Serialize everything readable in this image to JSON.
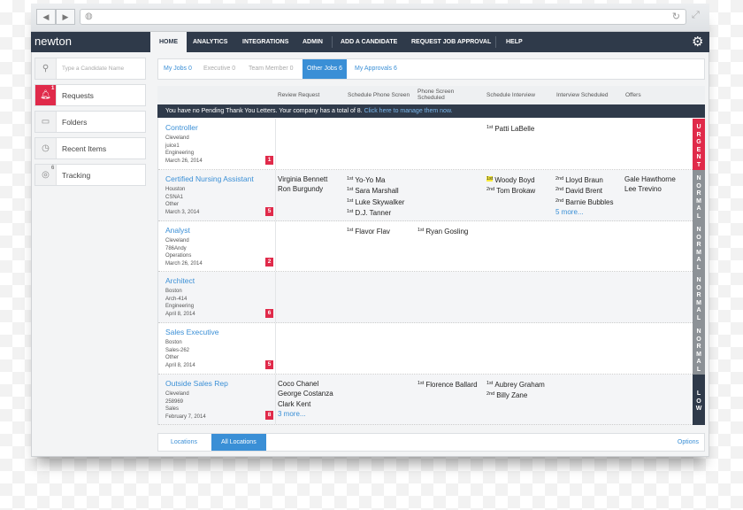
{
  "brand": "newton",
  "colors": {
    "accent": "#3a8fd6",
    "nav": "#2f3a4a",
    "urgent": "#e02a4a",
    "normal": "#8c9196",
    "low": "#2f3a4a"
  },
  "nav": {
    "items": [
      "HOME",
      "ANALYTICS",
      "INTEGRATIONS",
      "ADMIN",
      "ADD A CANDIDATE",
      "REQUEST JOB APPROVAL",
      "HELP"
    ],
    "settings_icon": "gear-icon"
  },
  "sidebar": {
    "search_placeholder": "Type a Candidate Name",
    "items": [
      {
        "label": "Requests",
        "badge": "1",
        "icon": "bell-icon"
      },
      {
        "label": "Folders",
        "icon": "folder-icon"
      },
      {
        "label": "Recent Items",
        "icon": "clock-icon"
      },
      {
        "label": "Tracking",
        "badge": "6",
        "icon": "target-icon"
      }
    ]
  },
  "tabs": [
    "My Jobs 0",
    "Executive 0",
    "Team Member 0",
    "Other Jobs 6",
    "My Approvals 6"
  ],
  "columns": [
    "Review Request",
    "Schedule Phone Screen",
    "Phone Screen Scheduled",
    "Schedule Interview",
    "Interview Scheduled",
    "Offers"
  ],
  "banner": {
    "text": "You have no Pending Thank You Letters. Your company has a total of 8. ",
    "link": "Click here to manage them now."
  },
  "jobs": [
    {
      "title": "Controller",
      "meta": [
        "Cleveland",
        "juice1",
        "Engineering",
        "March 26, 2014"
      ],
      "count": "1",
      "priority": "URGENT",
      "cells": [
        [],
        [],
        [],
        [
          {
            "rank": "1st",
            "name": "Patti LaBelle"
          }
        ],
        [],
        []
      ]
    },
    {
      "title": "Certified Nursing Assistant",
      "meta": [
        "Houston",
        "CSNA1",
        "Other",
        "March 3, 2014"
      ],
      "count": "5",
      "priority": "NORMAL",
      "cells": [
        [
          {
            "name": "Virginia Bennett"
          },
          {
            "name": "Ron Burgundy"
          }
        ],
        [
          {
            "rank": "1st",
            "name": "Yo-Yo Ma"
          },
          {
            "rank": "1st",
            "name": "Sara Marshall"
          },
          {
            "rank": "1st",
            "name": "Luke Skywalker"
          },
          {
            "rank": "1st",
            "name": "D.J. Tanner"
          }
        ],
        [],
        [
          {
            "rank": "1st",
            "name": "Woody Boyd",
            "highlight": true
          },
          {
            "rank": "2nd",
            "name": "Tom Brokaw"
          }
        ],
        [
          {
            "rank": "2nd",
            "name": "Lloyd Braun"
          },
          {
            "rank": "2nd",
            "name": "David Brent"
          },
          {
            "rank": "2nd",
            "name": "Barnie Bubbles"
          },
          {
            "more": "5 more..."
          }
        ],
        [
          {
            "name": "Gale Hawthorne"
          },
          {
            "name": "Lee Trevino"
          }
        ]
      ]
    },
    {
      "title": "Analyst",
      "meta": [
        "Cleveland",
        "786Andy",
        "Operations",
        "March 26, 2014"
      ],
      "count": "2",
      "priority": "NORMAL",
      "cells": [
        [],
        [
          {
            "rank": "1st",
            "name": "Flavor Flav"
          }
        ],
        [
          {
            "rank": "1st",
            "name": "Ryan Gosling"
          }
        ],
        [],
        [],
        []
      ]
    },
    {
      "title": "Architect",
      "meta": [
        "Boston",
        "Arch-414",
        "Engineering",
        "April 8, 2014"
      ],
      "count": "6",
      "priority": "NORMAL",
      "cells": [
        [],
        [],
        [],
        [],
        [],
        []
      ]
    },
    {
      "title": "Sales Executive",
      "meta": [
        "Boston",
        "Sales-262",
        "Other",
        "April 8, 2014"
      ],
      "count": "5",
      "priority": "NORMAL",
      "cells": [
        [],
        [],
        [],
        [],
        [],
        []
      ]
    },
    {
      "title": "Outside Sales Rep",
      "meta": [
        "Cleveland",
        "258969",
        "Sales",
        "February 7, 2014"
      ],
      "count": "8",
      "priority": "LOW",
      "cells": [
        [
          {
            "name": "Coco Chanel"
          },
          {
            "name": "George Costanza"
          },
          {
            "name": "Clark Kent"
          },
          {
            "more": "3 more..."
          }
        ],
        [],
        [
          {
            "rank": "1st",
            "name": "Florence Ballard"
          }
        ],
        [
          {
            "rank": "1st",
            "name": "Aubrey Graham"
          },
          {
            "rank": "2nd",
            "name": "Billy Zane"
          }
        ],
        [],
        []
      ]
    }
  ],
  "footer": {
    "tabs": [
      "Locations",
      "All Locations"
    ],
    "options": "Options"
  }
}
